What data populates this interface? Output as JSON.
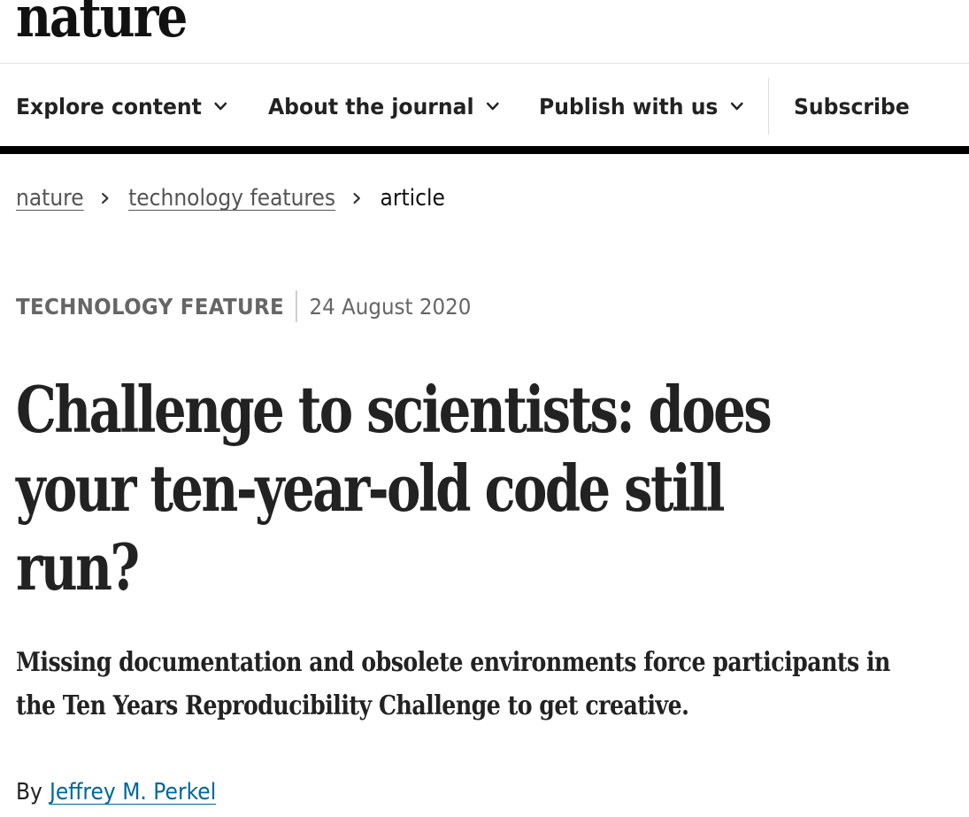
{
  "site": {
    "logo_text": "nature"
  },
  "nav": {
    "items": [
      {
        "label": "Explore content",
        "icon": "chevron-down-icon"
      },
      {
        "label": "About the journal",
        "icon": "chevron-down-icon"
      },
      {
        "label": "Publish with us",
        "icon": "chevron-down-icon"
      }
    ],
    "subscribe_label": "Subscribe"
  },
  "breadcrumb": {
    "items": [
      {
        "label": "nature"
      },
      {
        "label": "technology features"
      }
    ],
    "current": "article",
    "separator_icon": "chevron-right-icon"
  },
  "article": {
    "type": "TECHNOLOGY FEATURE",
    "date": "24 August 2020",
    "title_lines": [
      "Challenge to scientists: does",
      "your ten-year-old code still",
      "run?"
    ],
    "standfirst_lines": [
      "Missing documentation and obsolete environments force participants in",
      "the Ten Years Reproducibility Challenge to get creative."
    ],
    "byline_prefix": "By",
    "author": "Jeffrey M. Perkel"
  },
  "colors": {
    "text": "#222222",
    "muted": "#666666",
    "link": "#006699",
    "rule": "#000000"
  }
}
